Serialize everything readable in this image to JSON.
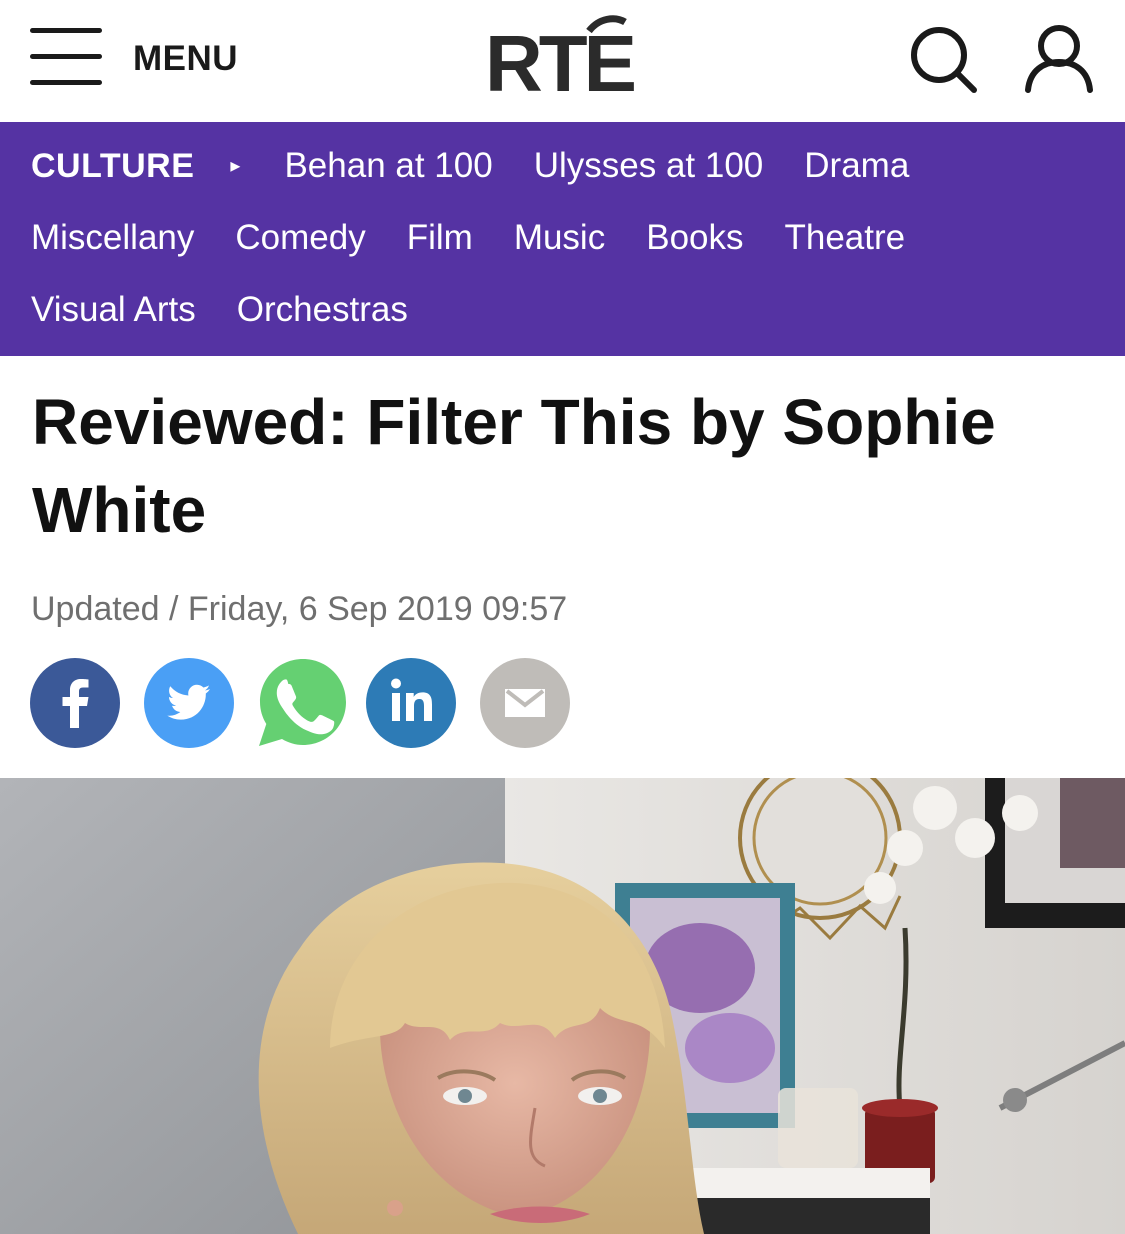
{
  "header": {
    "menu_label": "MENU",
    "logo_text": "RTE",
    "search_icon": "search-icon",
    "account_icon": "user-icon"
  },
  "subnav": {
    "section": "CULTURE",
    "arrow_icon": "triangle-right-icon",
    "row1": [
      "Behan at 100",
      "Ulysses at 100",
      "Drama"
    ],
    "row2": [
      "Miscellany",
      "Comedy",
      "Film",
      "Music",
      "Books",
      "Theatre"
    ],
    "row3": [
      "Visual Arts",
      "Orchestras"
    ]
  },
  "article": {
    "title": "Reviewed: Filter This by Sophie White",
    "updated": "Updated / Friday, 6 Sep 2019 09:57"
  },
  "share": [
    {
      "name": "facebook",
      "icon": "facebook-icon",
      "color": "#3b5998"
    },
    {
      "name": "twitter",
      "icon": "twitter-icon",
      "color": "#4a9ff5"
    },
    {
      "name": "whatsapp",
      "icon": "whatsapp-icon",
      "color": "#65d072"
    },
    {
      "name": "linkedin",
      "icon": "linkedin-icon",
      "color": "#2d7bb6"
    },
    {
      "name": "email",
      "icon": "email-icon",
      "color": "#bfbcb8"
    }
  ],
  "colors": {
    "nav_purple": "#5533a3",
    "headline": "#111111",
    "meta_grey": "#6f6f6f"
  },
  "hero_image": {
    "description_icon": "photo-of-woman-with-blonde-fringe"
  }
}
